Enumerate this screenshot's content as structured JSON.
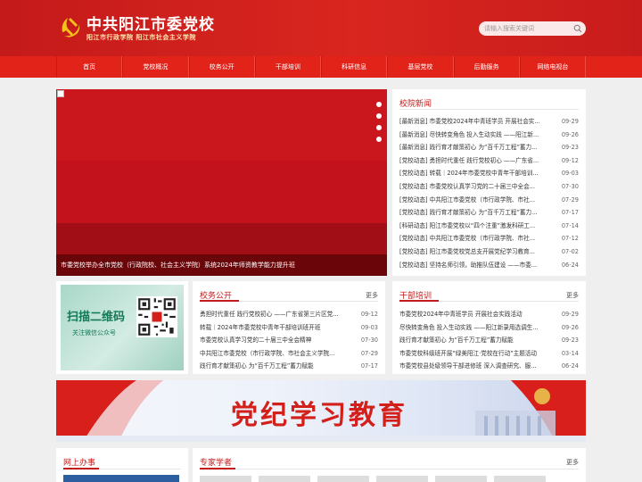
{
  "header": {
    "title": "中共阳江市委党校",
    "subtitle": "阳江市行政学院   阳江市社会主义学院",
    "search_placeholder": "请输入搜索关键词"
  },
  "colors": {
    "primary_red": "#c41a1a",
    "nav_red": "#e2231a",
    "banner_text": "#d3201b"
  },
  "nav": [
    "首页",
    "党校概况",
    "校务公开",
    "干部培训",
    "科研信息",
    "基层党校",
    "后勤服务",
    "网络电视台"
  ],
  "slider": {
    "caption": "市委党校举办全市党校（行政院校、社会主义学院）系统2024年师资教学能力提升班"
  },
  "news": {
    "title": "校院新闻",
    "items": [
      {
        "text": "[最新消息] 市委党校2024年中青班学员 开展社会实...",
        "date": "09-29"
      },
      {
        "text": "[最新消息] 尽快转变角色 投入生动实践 ——阳江新...",
        "date": "09-26"
      },
      {
        "text": "[最新消息] 践行育才献策初心 为“百千万工程”蓄力...",
        "date": "09-23"
      },
      {
        "text": "[党校动态] 勇担时代重任 践行党校初心 ——广东省...",
        "date": "09-12"
      },
      {
        "text": "[党校动态] 转载｜2024年市委党校中青年干部培训...",
        "date": "09-03"
      },
      {
        "text": "[党校动态] 市委党校认真学习党的二十届三中全会...",
        "date": "07-30"
      },
      {
        "text": "[党校动态] 中共阳江市委党校（市行政学院、市社...",
        "date": "07-29"
      },
      {
        "text": "[党校动态] 践行育才献策初心 为“百千万工程”蓄力...",
        "date": "07-17"
      },
      {
        "text": "[科研动态] 阳江市委党校以“四个注重”激发科研工...",
        "date": "07-14"
      },
      {
        "text": "[党校动态] 中共阳江市委党校（市行政学院、市社...",
        "date": "07-12"
      },
      {
        "text": "[党校动态] 阳江市委党校党总支开展党纪学习教育...",
        "date": "07-02"
      },
      {
        "text": "[党校动态] 坚持名师引领，助推队伍建设 ——市委...",
        "date": "06-24"
      }
    ]
  },
  "affairs": {
    "title": "校务公开",
    "more": "更多",
    "items": [
      {
        "text": "勇担时代重任 践行党校初心 ——广东省第三片区党...",
        "date": "09-12"
      },
      {
        "text": "转载｜2024年市委党校中青年干部培训班开班",
        "date": "09-03"
      },
      {
        "text": "市委党校认真学习党的二十届三中全会精神",
        "date": "07-30"
      },
      {
        "text": "中共阳江市委党校（市行政学院、市社会主义学院...",
        "date": "07-29"
      },
      {
        "text": "践行育才献策初心 为“百千万工程”蓄力赋能",
        "date": "07-17"
      }
    ]
  },
  "training": {
    "title": "干部培训",
    "more": "更多",
    "items": [
      {
        "text": "市委党校2024年中青班学员 开展社会实践活动",
        "date": "09-29"
      },
      {
        "text": "尽快转变角色 投入生动实践 ——阳江新录用选调生...",
        "date": "09-26"
      },
      {
        "text": "践行育才献策初心 为“百千万工程”蓄力赋能",
        "date": "09-23"
      },
      {
        "text": "市委党校科级班开展“绿美阳江·党校在行动”主题活动",
        "date": "03-14"
      },
      {
        "text": "市委党校县处级领导干部进修班 深入调查研究、服...",
        "date": "06-24"
      }
    ]
  },
  "qr": {
    "scan": "扫描二维码",
    "follow": "关注微信公众号"
  },
  "banner": {
    "text": "党纪学习教育"
  },
  "online": {
    "title": "网上办事"
  },
  "experts": {
    "title": "专家学者",
    "more": "更多"
  }
}
